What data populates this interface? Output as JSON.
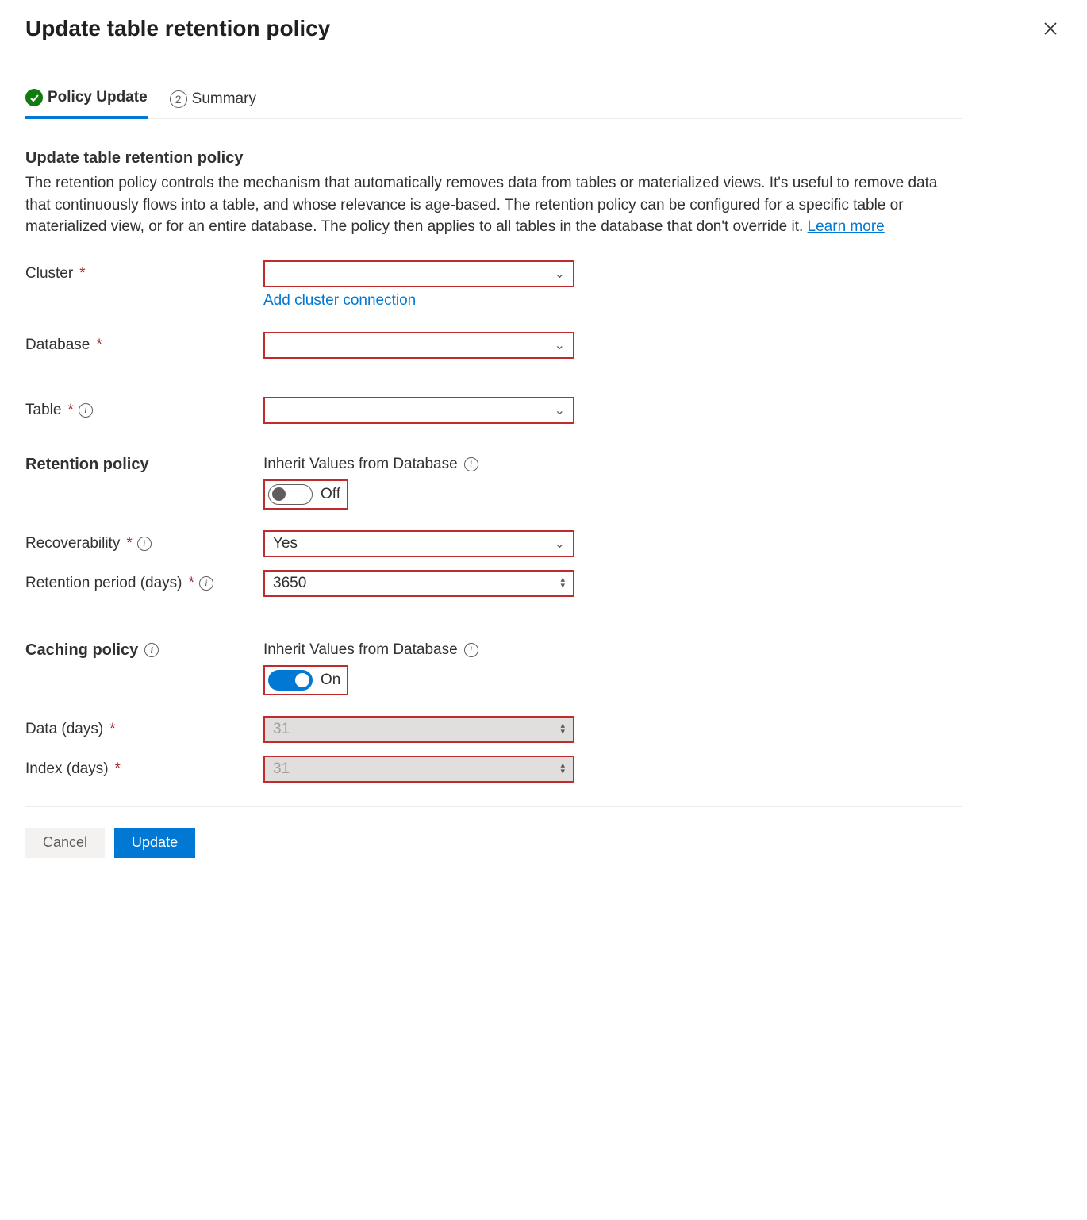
{
  "title": "Update table retention policy",
  "tabs": {
    "policy_update": "Policy Update",
    "summary": "Summary",
    "summary_num": "2"
  },
  "intro": {
    "heading": "Update table retention policy",
    "body": "The retention policy controls the mechanism that automatically removes data from tables or materialized views. It's useful to remove data that continuously flows into a table, and whose relevance is age-based. The retention policy can be configured for a specific table or materialized view, or for an entire database. The policy then applies to all tables in the database that don't override it. ",
    "learn_more": "Learn more"
  },
  "labels": {
    "cluster": "Cluster",
    "add_cluster": "Add cluster connection",
    "database": "Database",
    "table": "Table",
    "retention_policy": "Retention policy",
    "inherit": "Inherit Values from Database",
    "off": "Off",
    "on": "On",
    "recoverability": "Recoverability",
    "retention_period": "Retention period (days)",
    "caching_policy": "Caching policy",
    "data_days": "Data (days)",
    "index_days": "Index (days)"
  },
  "values": {
    "recoverability": "Yes",
    "retention_period": "3650",
    "data_days": "31",
    "index_days": "31"
  },
  "buttons": {
    "cancel": "Cancel",
    "update": "Update"
  }
}
